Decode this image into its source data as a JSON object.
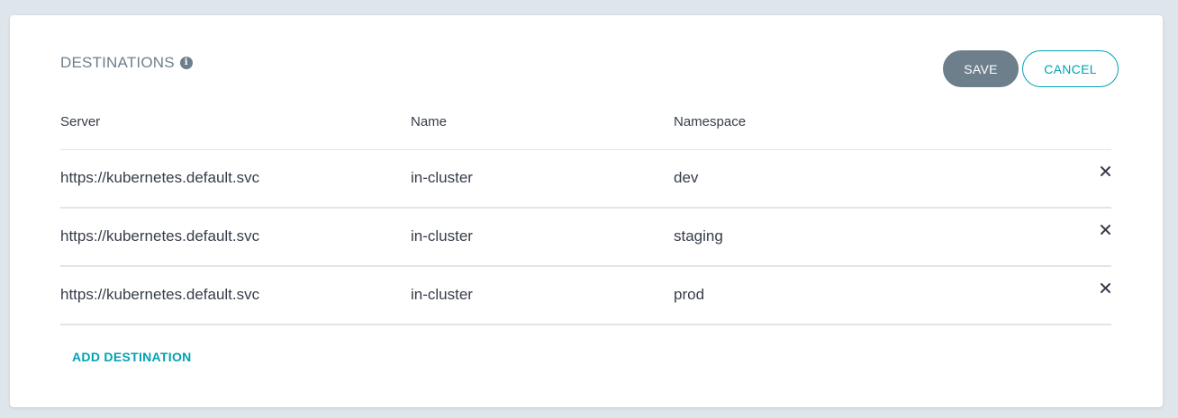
{
  "section": {
    "title": "DESTINATIONS",
    "info_icon": "info-icon"
  },
  "actions": {
    "save_label": "SAVE",
    "cancel_label": "CANCEL"
  },
  "table": {
    "headers": {
      "server": "Server",
      "name": "Name",
      "namespace": "Namespace"
    },
    "rows": [
      {
        "server": "https://kubernetes.default.svc",
        "name": "in-cluster",
        "namespace": "dev"
      },
      {
        "server": "https://kubernetes.default.svc",
        "name": "in-cluster",
        "namespace": "staging"
      },
      {
        "server": "https://kubernetes.default.svc",
        "name": "in-cluster",
        "namespace": "prod"
      }
    ],
    "remove_icon": "close-icon"
  },
  "add_destination_label": "ADD DESTINATION",
  "colors": {
    "background": "#dee6eb",
    "card": "#ffffff",
    "save_button": "#6d7f8b",
    "accent": "#00a2b3",
    "text": "#363c4a"
  }
}
